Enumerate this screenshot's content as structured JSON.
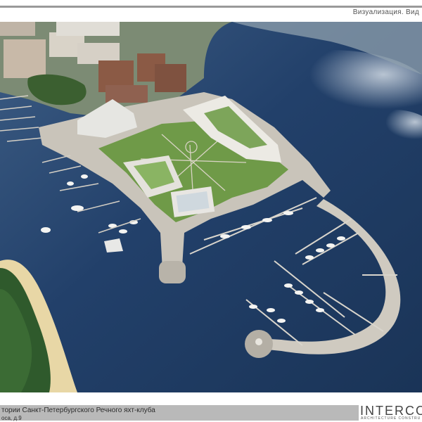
{
  "header": {
    "caption": "Визуализация. Вид"
  },
  "footer": {
    "title": "тории Санкт-Петербургского Речного яхт-клуба",
    "address": "оса, д.9"
  },
  "logo": {
    "wordmark": "INTERCOL",
    "tagline": "ARCHITECTURE CONSTRU"
  },
  "colors": {
    "water": "#1e3a5e",
    "water_light": "#3b5a80",
    "pier": "#c9c4ba",
    "park": "#6f9a48",
    "sand": "#e8d7a6",
    "forest": "#2f5a2c",
    "footer_bar": "#b9b9b9"
  },
  "image": {
    "subject": "aerial-marina-rendering"
  }
}
